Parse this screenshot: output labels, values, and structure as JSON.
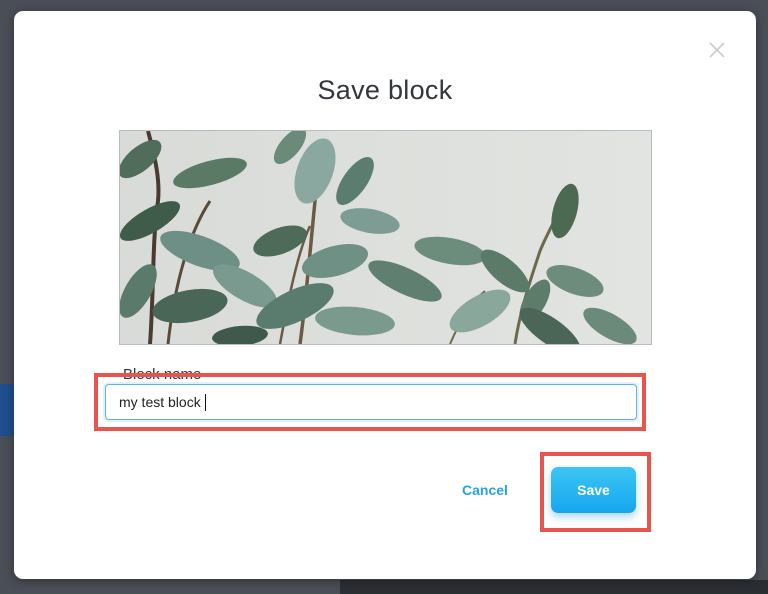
{
  "dialog": {
    "title": "Save block",
    "close_icon": "close-icon",
    "preview_image": "ficus-plant-leaves-photo",
    "field_label": "Block name",
    "name_value": "my test block",
    "cancel_label": "Cancel",
    "save_label": "Save",
    "highlight_color": "#e8554d",
    "accent_color": "#1aa8ee"
  }
}
